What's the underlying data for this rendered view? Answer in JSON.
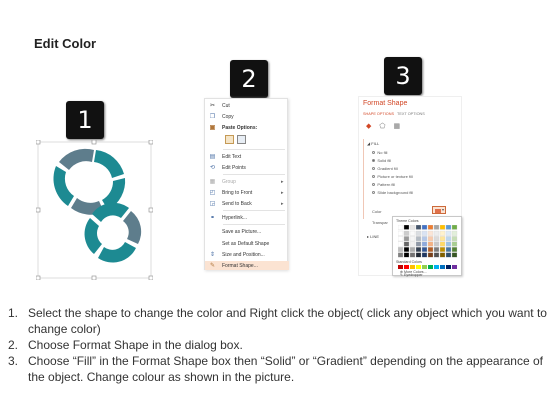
{
  "title": "Edit Color",
  "badges": [
    "1",
    "2",
    "3"
  ],
  "colors": {
    "teal": "#1d8a92",
    "slate": "#5e7d8c",
    "accent": "#d24726",
    "highlight": "#fbe3d2"
  },
  "context_menu": {
    "items": [
      {
        "icon": "scissors-icon",
        "label": "Cut"
      },
      {
        "icon": "copy-icon",
        "label": "Copy"
      },
      {
        "icon": "paste-icon",
        "label": "Paste Options:"
      },
      {
        "icon": "edit-text-icon",
        "label": "Edit Text"
      },
      {
        "icon": "edit-points-icon",
        "label": "Edit Points"
      },
      {
        "icon": "group-icon",
        "label": "Group"
      },
      {
        "icon": "bring-front-icon",
        "label": "Bring to Front"
      },
      {
        "icon": "send-back-icon",
        "label": "Send to Back"
      },
      {
        "icon": "hyperlink-icon",
        "label": "Hyperlink..."
      },
      {
        "icon": "",
        "label": "Save as Picture..."
      },
      {
        "icon": "",
        "label": "Set as Default Shape"
      },
      {
        "icon": "size-position-icon",
        "label": "Size and Position..."
      },
      {
        "icon": "format-shape-icon",
        "label": "Format Shape..."
      }
    ]
  },
  "format_shape": {
    "title": "Format Shape",
    "tabs": [
      "SHAPE OPTIONS",
      "TEXT OPTIONS"
    ],
    "fill_section": "FILL",
    "fill_options": [
      "No fill",
      "Solid fill",
      "Gradient fill",
      "Picture or texture fill",
      "Pattern fill",
      "Slide background fill"
    ],
    "selected_option": "Solid fill",
    "color_label": "Color",
    "transparency_label": "Transpar",
    "line_section": "LINE",
    "palette": {
      "theme_label": "Theme Colors",
      "standard_label": "Standard Colors",
      "more_colors": "More Colors...",
      "eyedropper": "Eyedropper",
      "theme_top": [
        "#ffffff",
        "#000000",
        "#e7e6e6",
        "#44546a",
        "#4472c4",
        "#ed7d31",
        "#a5a5a5",
        "#ffc000",
        "#5b9bd5",
        "#70ad47"
      ],
      "standard": [
        "#c00000",
        "#ff0000",
        "#ffc000",
        "#ffff00",
        "#92d050",
        "#00b050",
        "#00b0f0",
        "#0070c0",
        "#002060",
        "#7030a0"
      ]
    }
  },
  "steps": [
    {
      "num": "1.",
      "text": "Select the shape to change the color and Right click the object( click any object which you want to change color)"
    },
    {
      "num": "2.",
      "text": "Choose Format Shape in the dialog box."
    },
    {
      "num": "3.",
      "text": "Choose “Fill” in the Format Shape box then “Solid” or “Gradient” depending on the appearance of the object. Change colour as shown in the picture."
    }
  ]
}
